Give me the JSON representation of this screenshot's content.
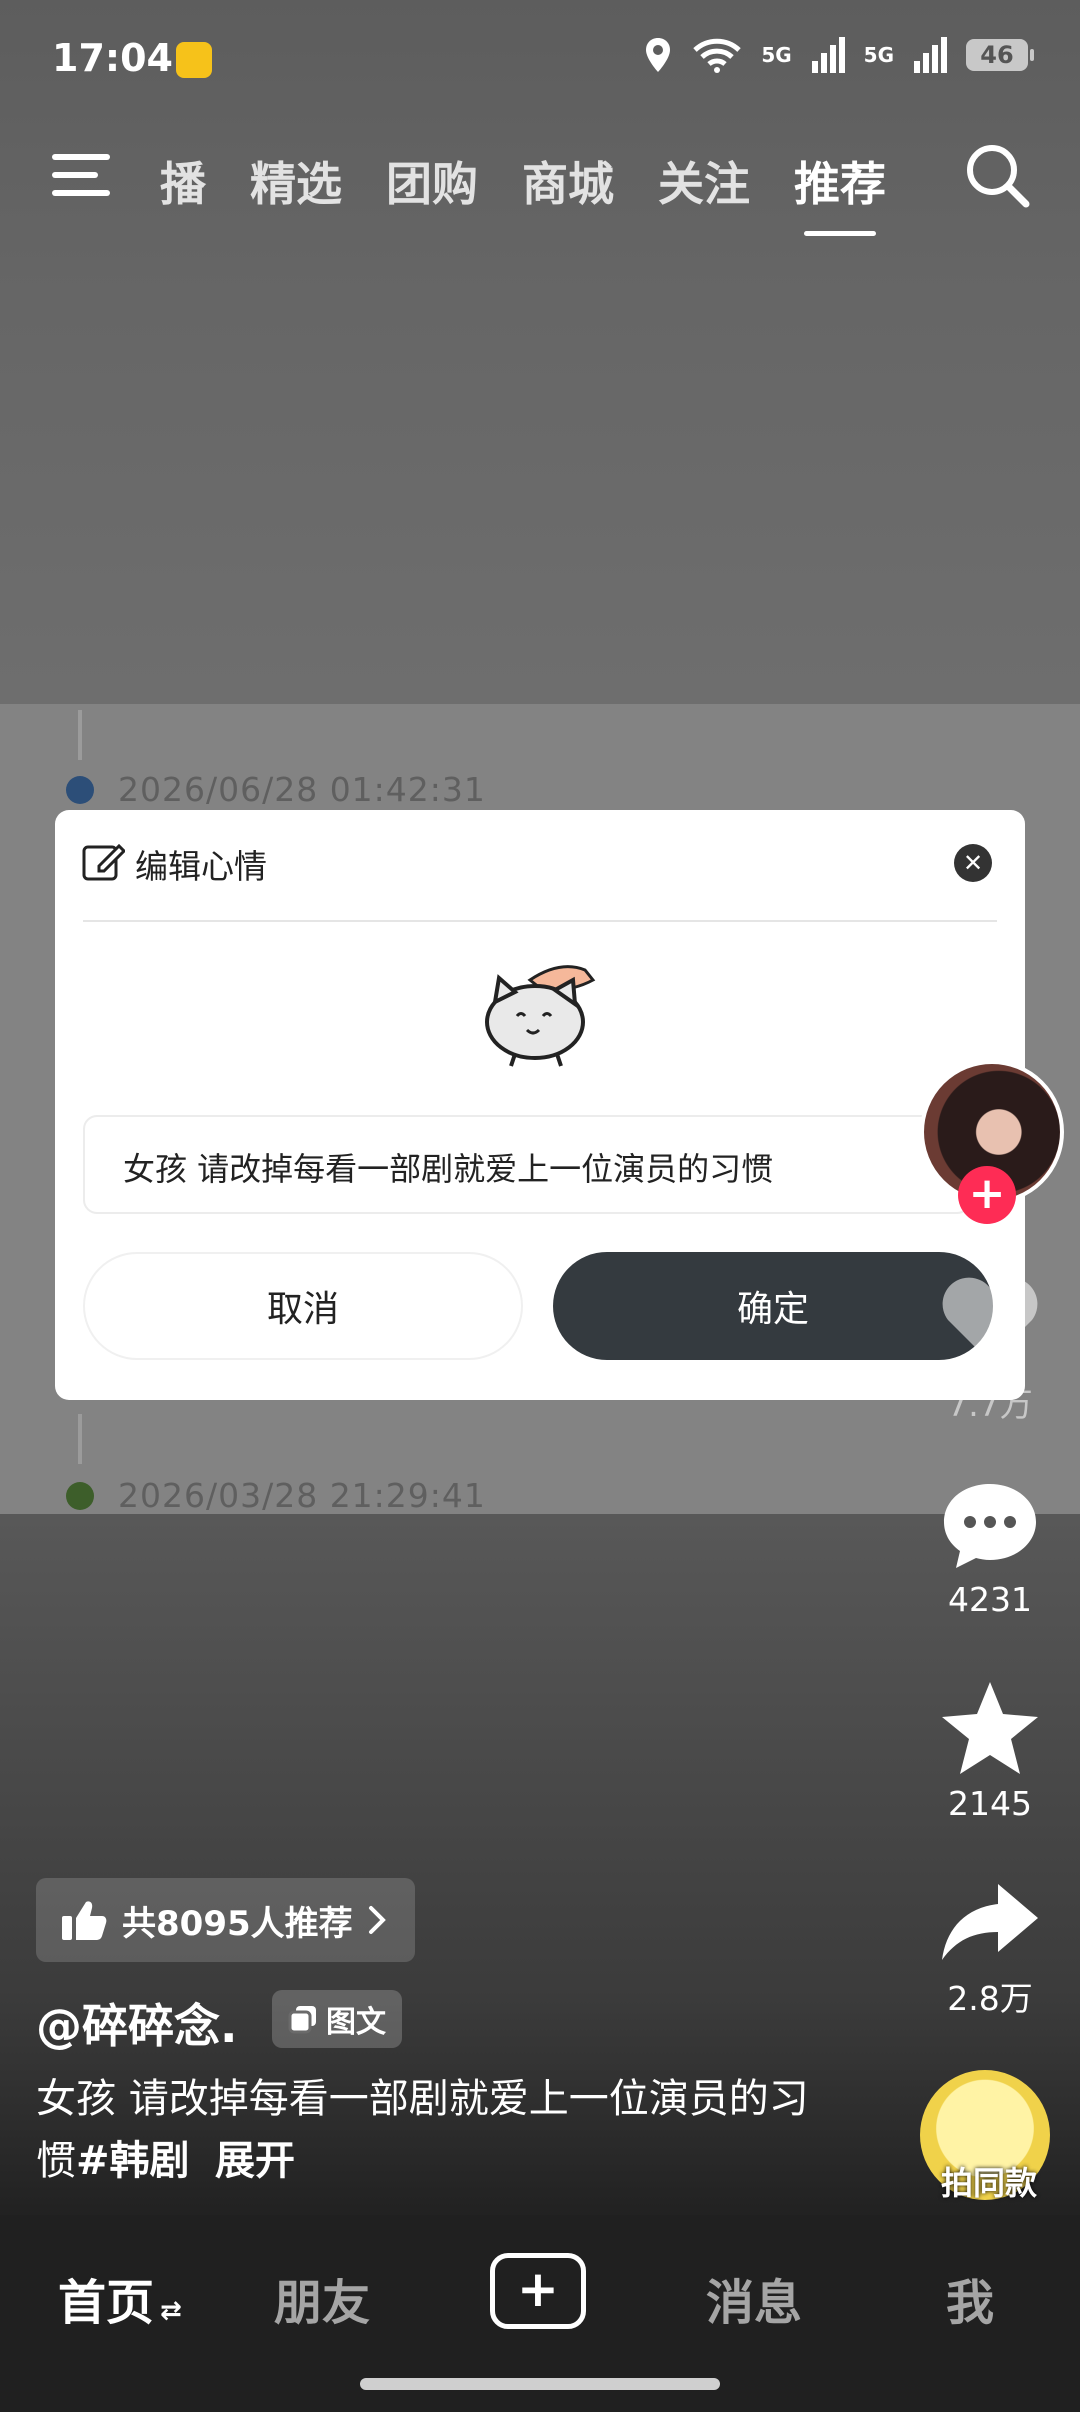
{
  "status_bar": {
    "time": "17:04",
    "signal1": "5G",
    "signal2": "5G",
    "battery": "46"
  },
  "top_nav": {
    "tabs": [
      "播",
      "精选",
      "团购",
      "商城",
      "关注",
      "推荐"
    ],
    "active_tab": "推荐"
  },
  "timeline": {
    "entries": [
      {
        "date": "2026/06/28 01:42:31",
        "dot_color": "#2c4e78"
      },
      {
        "date": "2026/03/28 21:29:41",
        "dot_color": "#3d5e2a"
      }
    ]
  },
  "dialog": {
    "title": "编辑心情",
    "input_value": "女孩 请改掉每看一部剧就爱上一位演员的习惯",
    "cancel_label": "取消",
    "confirm_label": "确定"
  },
  "actions": {
    "like_count": "7.7万",
    "comment_count": "4231",
    "favorite_count": "2145",
    "share_count": "2.8万",
    "same_style_label": "拍同款"
  },
  "post": {
    "recommend_text": "共8095人推荐",
    "author": "@碎碎念.",
    "type_tag": "图文",
    "desc_text": "女孩 请改掉每看一部剧就爱上一位演员的习惯",
    "hashtag": "#韩剧",
    "expand_label": "展开"
  },
  "bottom_nav": {
    "home": "首页",
    "friends": "朋友",
    "messages": "消息",
    "me": "我"
  },
  "colors": {
    "accent_red": "#fe2c55",
    "confirm_button": "#343a3f"
  }
}
